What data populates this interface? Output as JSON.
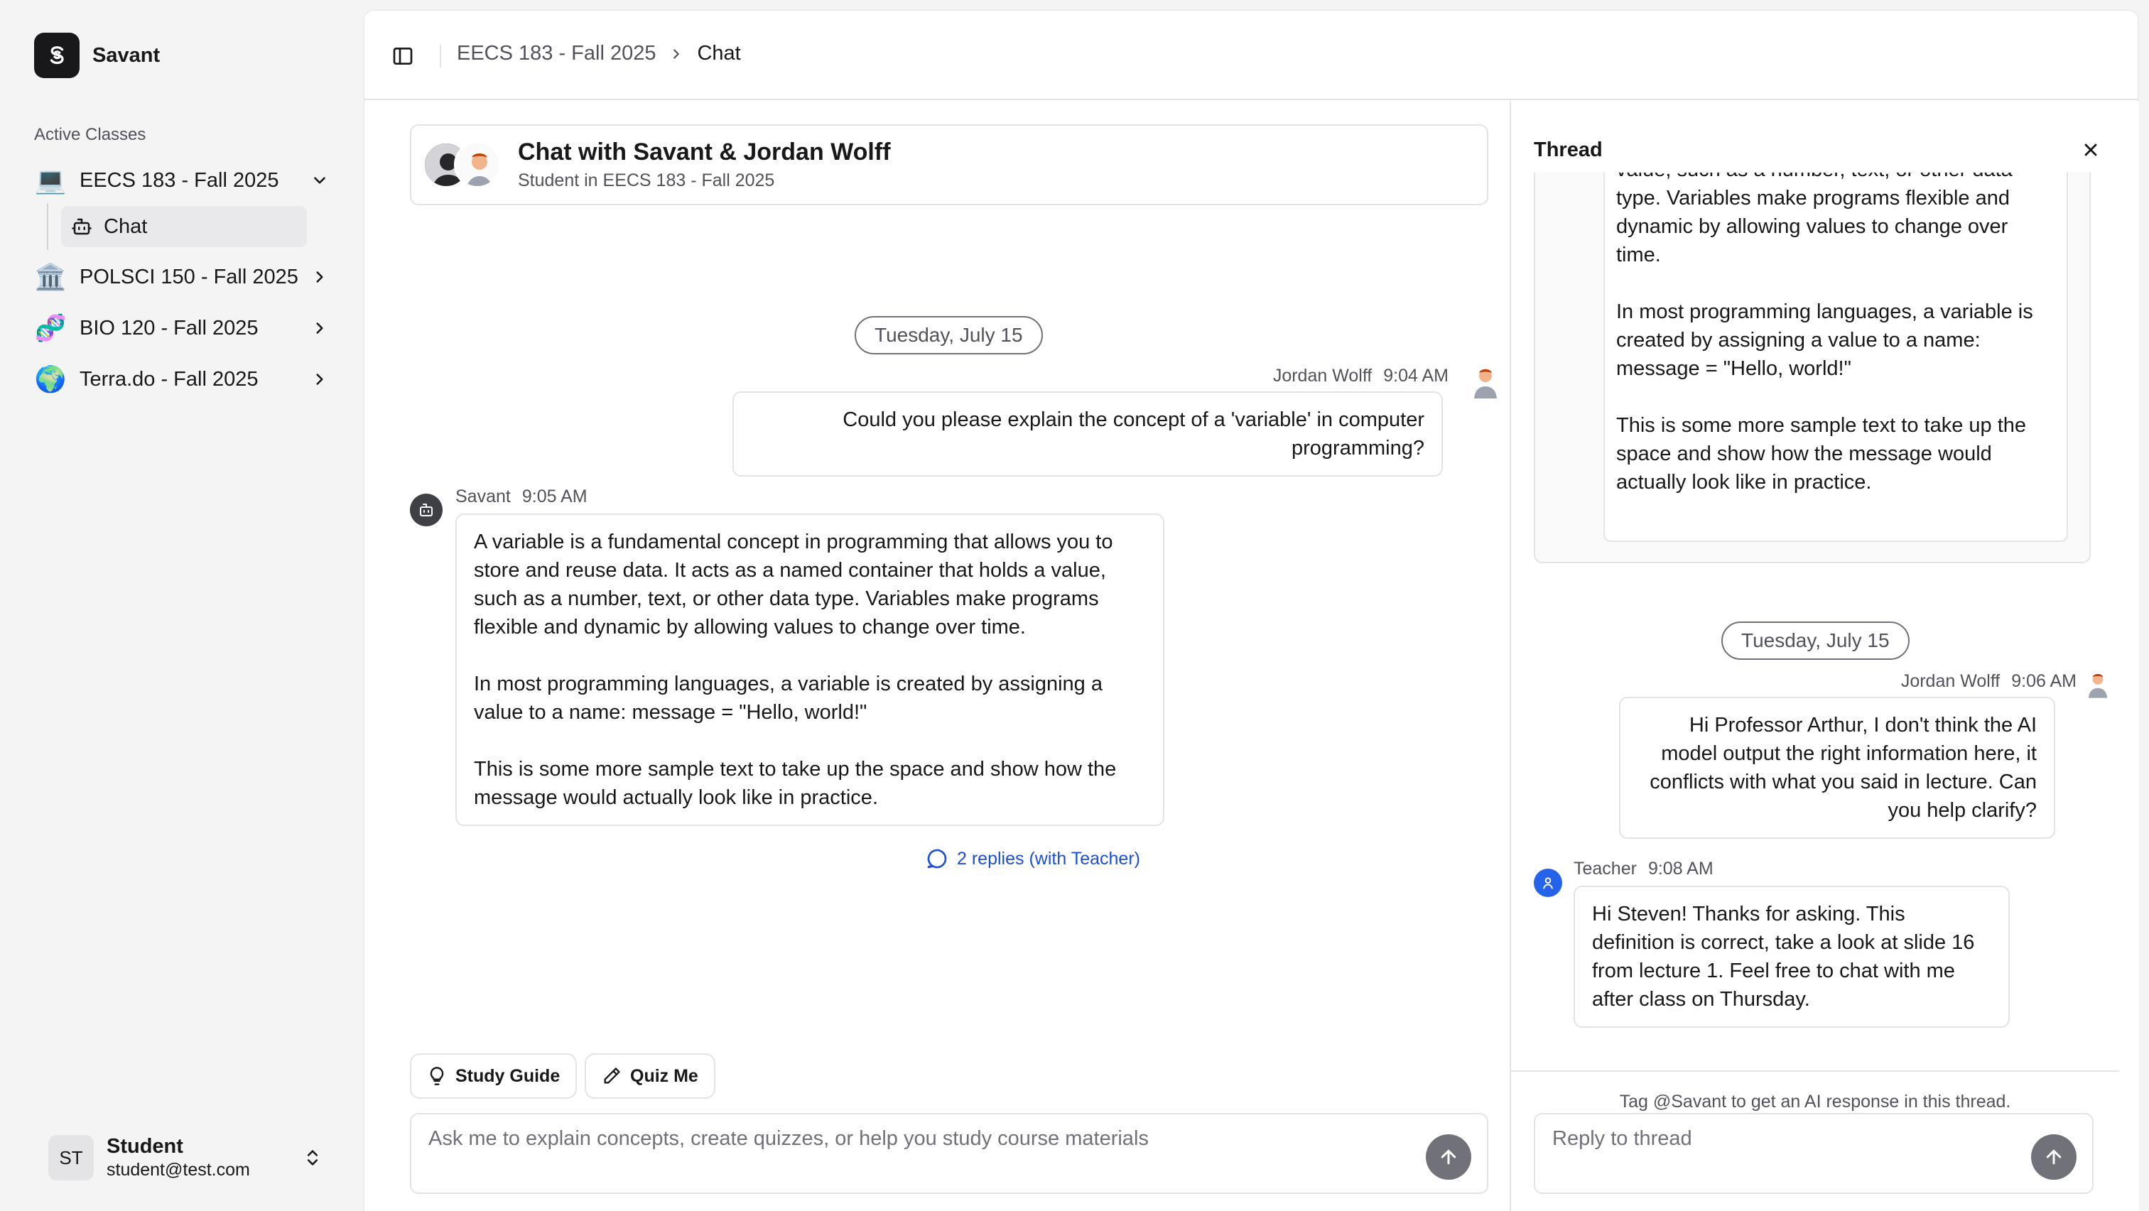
{
  "app": {
    "name": "Savant"
  },
  "sidebar": {
    "section_label": "Active Classes",
    "classes": [
      {
        "label": "EECS 183 - Fall 2025",
        "icon": "laptop-icon",
        "glyph": "💻",
        "expanded": true
      },
      {
        "label": "POLSCI 150 - Fall 2025",
        "icon": "classical-building-icon",
        "glyph": "🏛️",
        "expanded": false
      },
      {
        "label": "BIO 120 - Fall 2025",
        "icon": "dna-icon",
        "glyph": "🧬",
        "expanded": false
      },
      {
        "label": "Terra.do - Fall 2025",
        "icon": "globe-icon",
        "glyph": "🌍",
        "expanded": false
      }
    ],
    "sub_items": [
      {
        "label": "Chat",
        "icon": "bot-icon"
      }
    ],
    "user": {
      "initials": "ST",
      "name": "Student",
      "email": "student@test.com"
    }
  },
  "breadcrumb": {
    "parent": "EECS 183 - Fall 2025",
    "current": "Chat"
  },
  "chat": {
    "title": "Chat with Savant & Jordan Wolff",
    "subtitle": "Student in EECS 183 - Fall 2025",
    "date_divider": "Tuesday, July 15",
    "messages": [
      {
        "author": "Jordan Wolff",
        "time": "9:04 AM",
        "paragraphs": [
          "Could you please explain the concept of a 'variable' in computer programming?"
        ]
      },
      {
        "author": "Savant",
        "time": "9:05 AM",
        "paragraphs": [
          "A variable is a fundamental concept in programming that allows you to store and reuse data. It acts as a named container that holds a value, such as a number, text, or other data type. Variables make programs flexible and dynamic by allowing values to change over time.",
          "In most programming languages, a variable is created by assigning a value to a name: message = \"Hello, world!\"",
          "This is some more sample text to take up the space and show how the message would actually look like in practice."
        ],
        "replies_label": "2 replies (with Teacher)"
      }
    ],
    "quick_actions": {
      "study_guide": "Study Guide",
      "quiz_me": "Quiz Me"
    },
    "composer_placeholder": "Ask me to explain concepts, create quizzes, or help you study course materials"
  },
  "thread": {
    "title": "Thread",
    "original_clip_paragraphs": [
      "value, such as a number, text, or other data type. Variables make programs flexible and dynamic by allowing values to change over time.",
      "In most programming languages, a variable is created by assigning a value to a name: message = \"Hello, world!\"",
      "This is some more sample text to take up the space and show how the message would actually look like in practice."
    ],
    "date_divider": "Tuesday, July 15",
    "replies": [
      {
        "author": "Jordan Wolff",
        "time": "9:06 AM",
        "text": "Hi Professor Arthur, I don't think the AI model output the right information here, it conflicts with what you said in lecture. Can you help clarify?"
      },
      {
        "author": "Teacher",
        "time": "9:08 AM",
        "text": "Hi Steven! Thanks for asking. This definition is correct, take a look at slide 16 from lecture 1. Feel free to chat with me after class on Thursday."
      }
    ],
    "hint": "Tag @Savant to get an AI response in this thread.",
    "composer_placeholder": "Reply to thread"
  },
  "colors": {
    "accent_link": "#1d4ed8",
    "teacher": "#2563eb",
    "bot": "#3f3f46",
    "send": "#71717a"
  }
}
